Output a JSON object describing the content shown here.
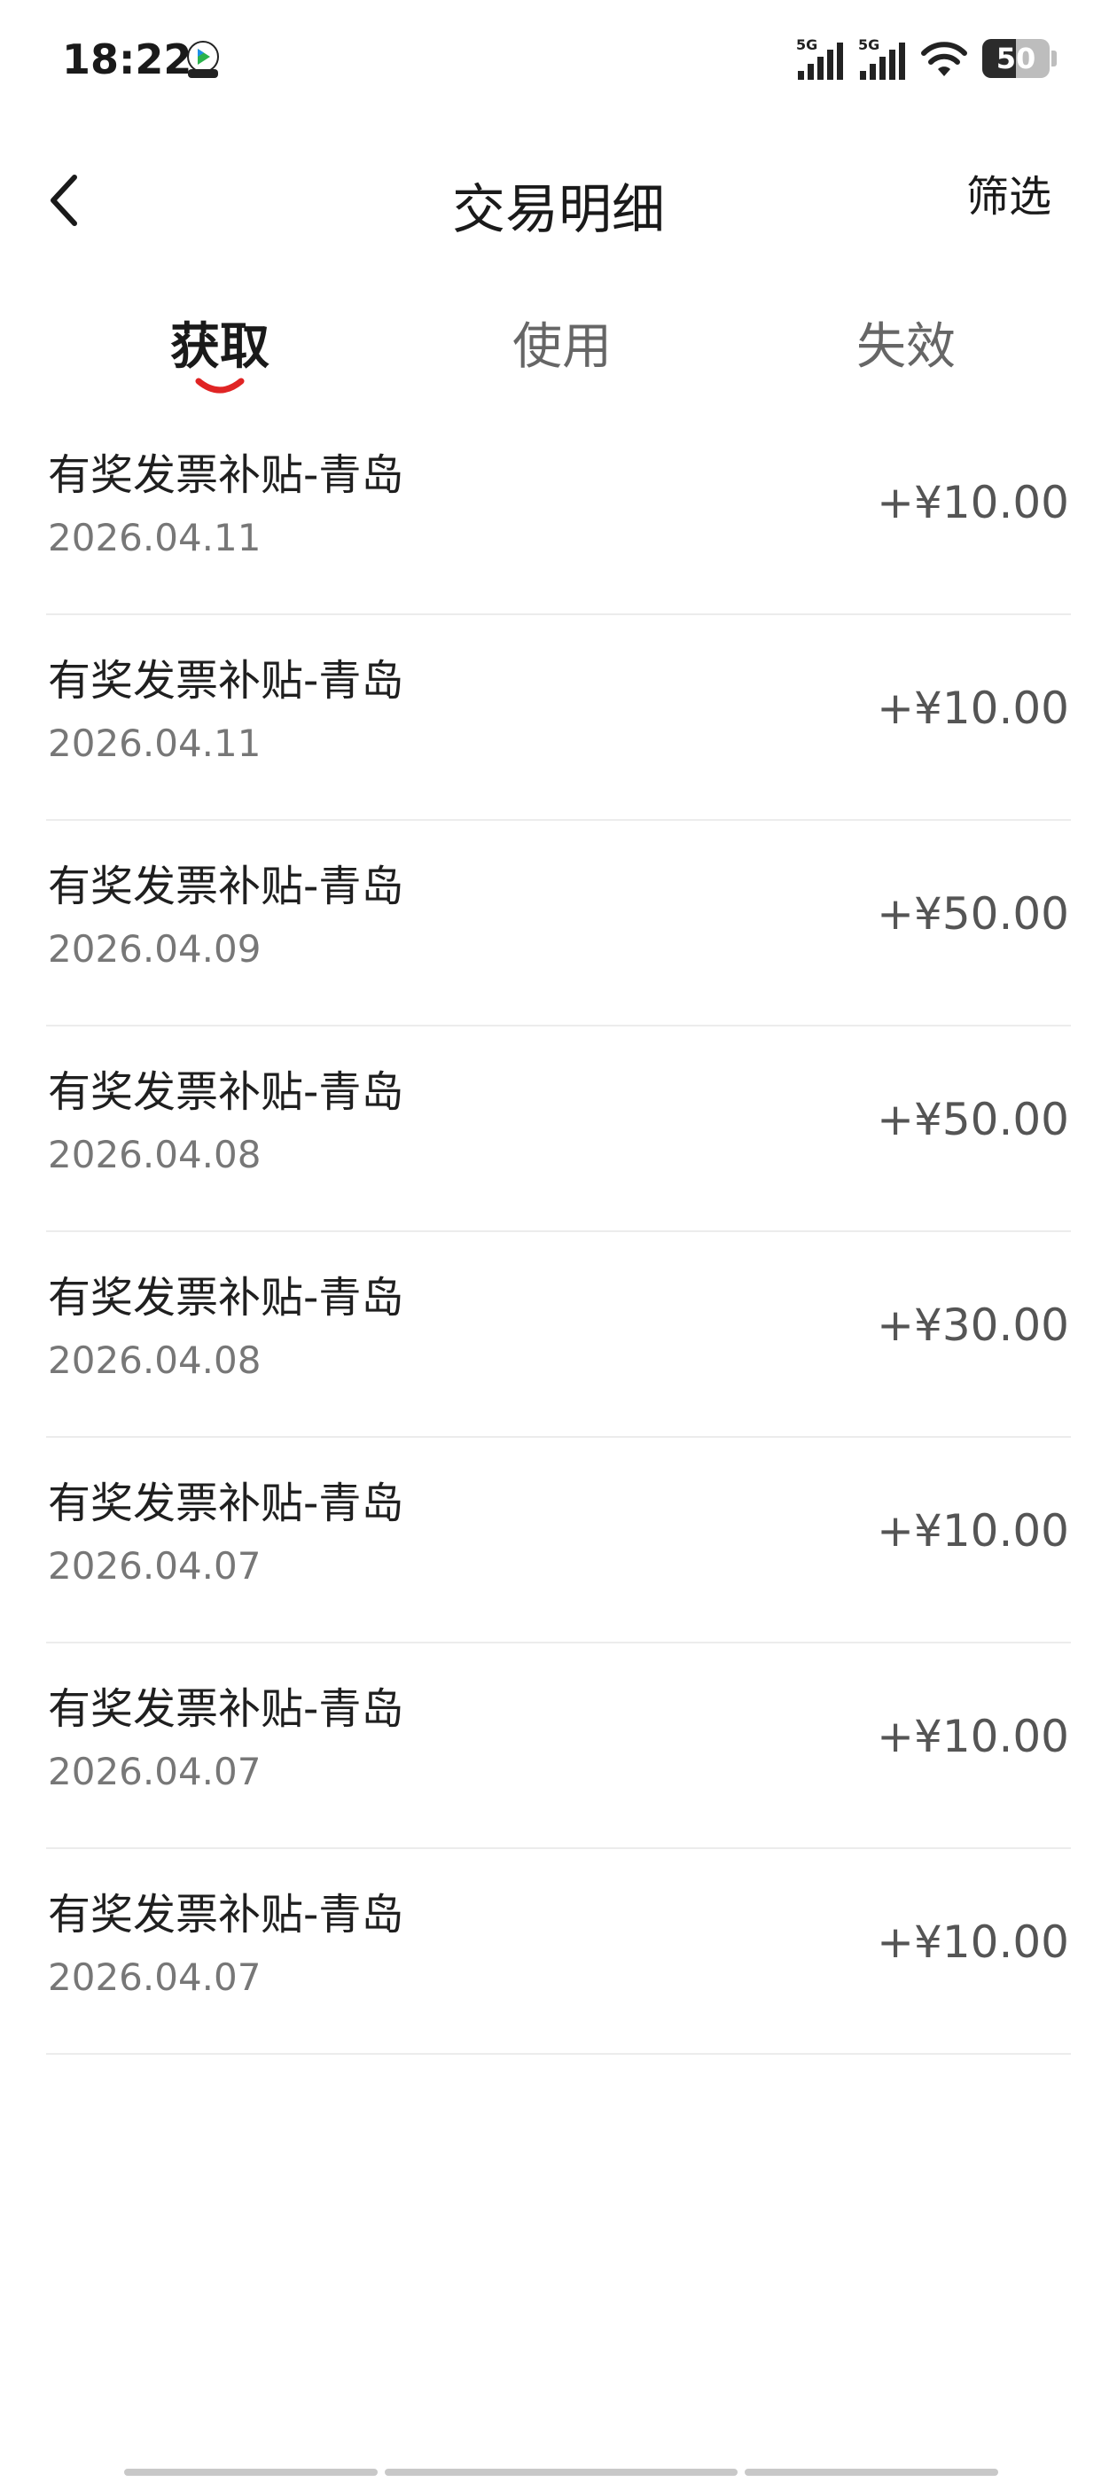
{
  "status_bar": {
    "time": "18:22",
    "signal1_label": "5G",
    "signal2_label": "5G",
    "battery": "50",
    "battery_level": 0.5
  },
  "header": {
    "title": "交易明细",
    "filter_label": "筛选"
  },
  "tabs": [
    {
      "label": "获取",
      "active": true
    },
    {
      "label": "使用",
      "active": false
    },
    {
      "label": "失效",
      "active": false
    }
  ],
  "colors": {
    "accent": "#e02424",
    "text_primary": "#1f1f1f",
    "text_secondary": "#777777",
    "divider": "#ececec"
  },
  "transactions": [
    {
      "title": "有奖发票补贴-青岛",
      "date": "2026.04.11",
      "amount": "+¥10.00"
    },
    {
      "title": "有奖发票补贴-青岛",
      "date": "2026.04.11",
      "amount": "+¥10.00"
    },
    {
      "title": "有奖发票补贴-青岛",
      "date": "2026.04.09",
      "amount": "+¥50.00"
    },
    {
      "title": "有奖发票补贴-青岛",
      "date": "2026.04.08",
      "amount": "+¥50.00"
    },
    {
      "title": "有奖发票补贴-青岛",
      "date": "2026.04.08",
      "amount": "+¥30.00"
    },
    {
      "title": "有奖发票补贴-青岛",
      "date": "2026.04.07",
      "amount": "+¥10.00"
    },
    {
      "title": "有奖发票补贴-青岛",
      "date": "2026.04.07",
      "amount": "+¥10.00"
    },
    {
      "title": "有奖发票补贴-青岛",
      "date": "2026.04.07",
      "amount": "+¥10.00"
    }
  ],
  "icons": {
    "back": "chevron-left-icon",
    "wifi": "wifi-icon",
    "signal": "cellular-signal-icon",
    "battery": "battery-icon",
    "app": "video-app-icon"
  }
}
